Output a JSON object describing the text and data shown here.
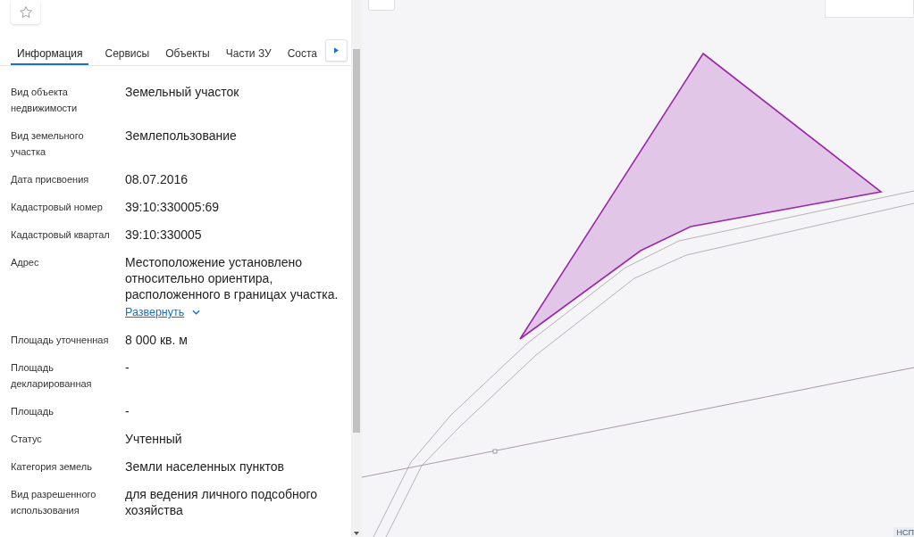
{
  "tabs": [
    {
      "label": "Информация",
      "selected": true
    },
    {
      "label": "Сервисы",
      "selected": false
    },
    {
      "label": "Объекты",
      "selected": false
    },
    {
      "label": "Части ЗУ",
      "selected": false
    },
    {
      "label": "Соста",
      "selected": false
    }
  ],
  "fields": [
    {
      "label": "Вид объекта недвижимости",
      "value": "Земельный участок"
    },
    {
      "label": "Вид земельного участка",
      "value": "Землепользование"
    },
    {
      "label": "Дата присвоения",
      "value": "08.07.2016"
    },
    {
      "label": "Кадастровый номер",
      "value": "39:10:330005:69"
    },
    {
      "label": "Кадастровый квартал",
      "value": "39:10:330005"
    },
    {
      "label": "Адрес",
      "value": "Местоположение установлено относительно ориентира, расположенного в границах участка.",
      "link": "Развернуть"
    },
    {
      "label": "Площадь уточненная",
      "value": "8 000 кв. м"
    },
    {
      "label": "Площадь декларированная",
      "value": "-"
    },
    {
      "label": "Площадь",
      "value": "-"
    },
    {
      "label": "Статус",
      "value": "Учтенный"
    },
    {
      "label": "Категория земель",
      "value": "Земли населенных пунктов"
    },
    {
      "label": "Вид разрешенного использования",
      "value": "для ведения личного подсобного хозяйства"
    }
  ],
  "map": {
    "badge": "НСП"
  }
}
